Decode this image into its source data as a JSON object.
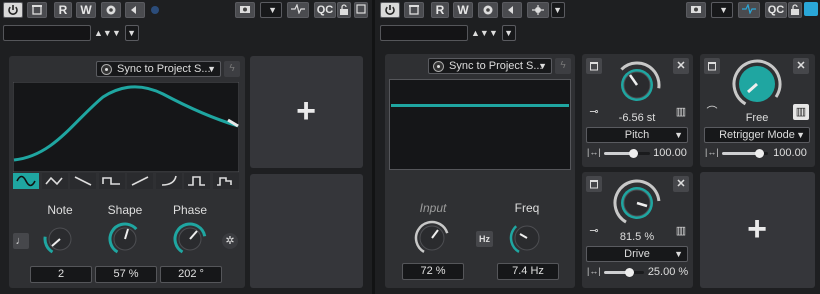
{
  "toolbar_left": {
    "power_icon": "power-icon",
    "bypass_icon": "bypass-icon",
    "read_label": "R",
    "write_label": "W",
    "record_icon": "record-icon",
    "back_icon": "arrow-left-icon",
    "qc_label": "QC"
  },
  "toolbar_right": {
    "qc_label": "QC",
    "accent_color": "#2aa7d8"
  },
  "lfo": {
    "sync_mode": "Sync to Project S...",
    "shapes": [
      "sine",
      "triangle",
      "ramp-down",
      "square",
      "ramp-up",
      "log",
      "pulse",
      "step"
    ],
    "active_shape": 0,
    "knobs": [
      {
        "label": "Note",
        "value": "2"
      },
      {
        "label": "Shape",
        "value": "57 %"
      },
      {
        "label": "Phase",
        "value": "202 °"
      }
    ],
    "wave_color": "#1fa6a1"
  },
  "follower": {
    "sync_mode": "Sync to Project S...",
    "input_label": "Input",
    "input_value": "72 %",
    "freq_label": "Freq",
    "freq_value": "7.4 Hz",
    "hz_label": "Hz"
  },
  "modules": [
    {
      "knob_value": "-6.56 st",
      "dropdown": "Pitch",
      "amount": "100.00",
      "fill": 0.55
    },
    {
      "knob_value": "Free",
      "dropdown": "Retrigger Mode",
      "amount": "100.00",
      "fill": 0.55
    },
    {
      "knob_value": "81.5 %",
      "dropdown": "Drive",
      "amount": "25.00 %",
      "fill": 0.35
    }
  ],
  "add_label": "+"
}
